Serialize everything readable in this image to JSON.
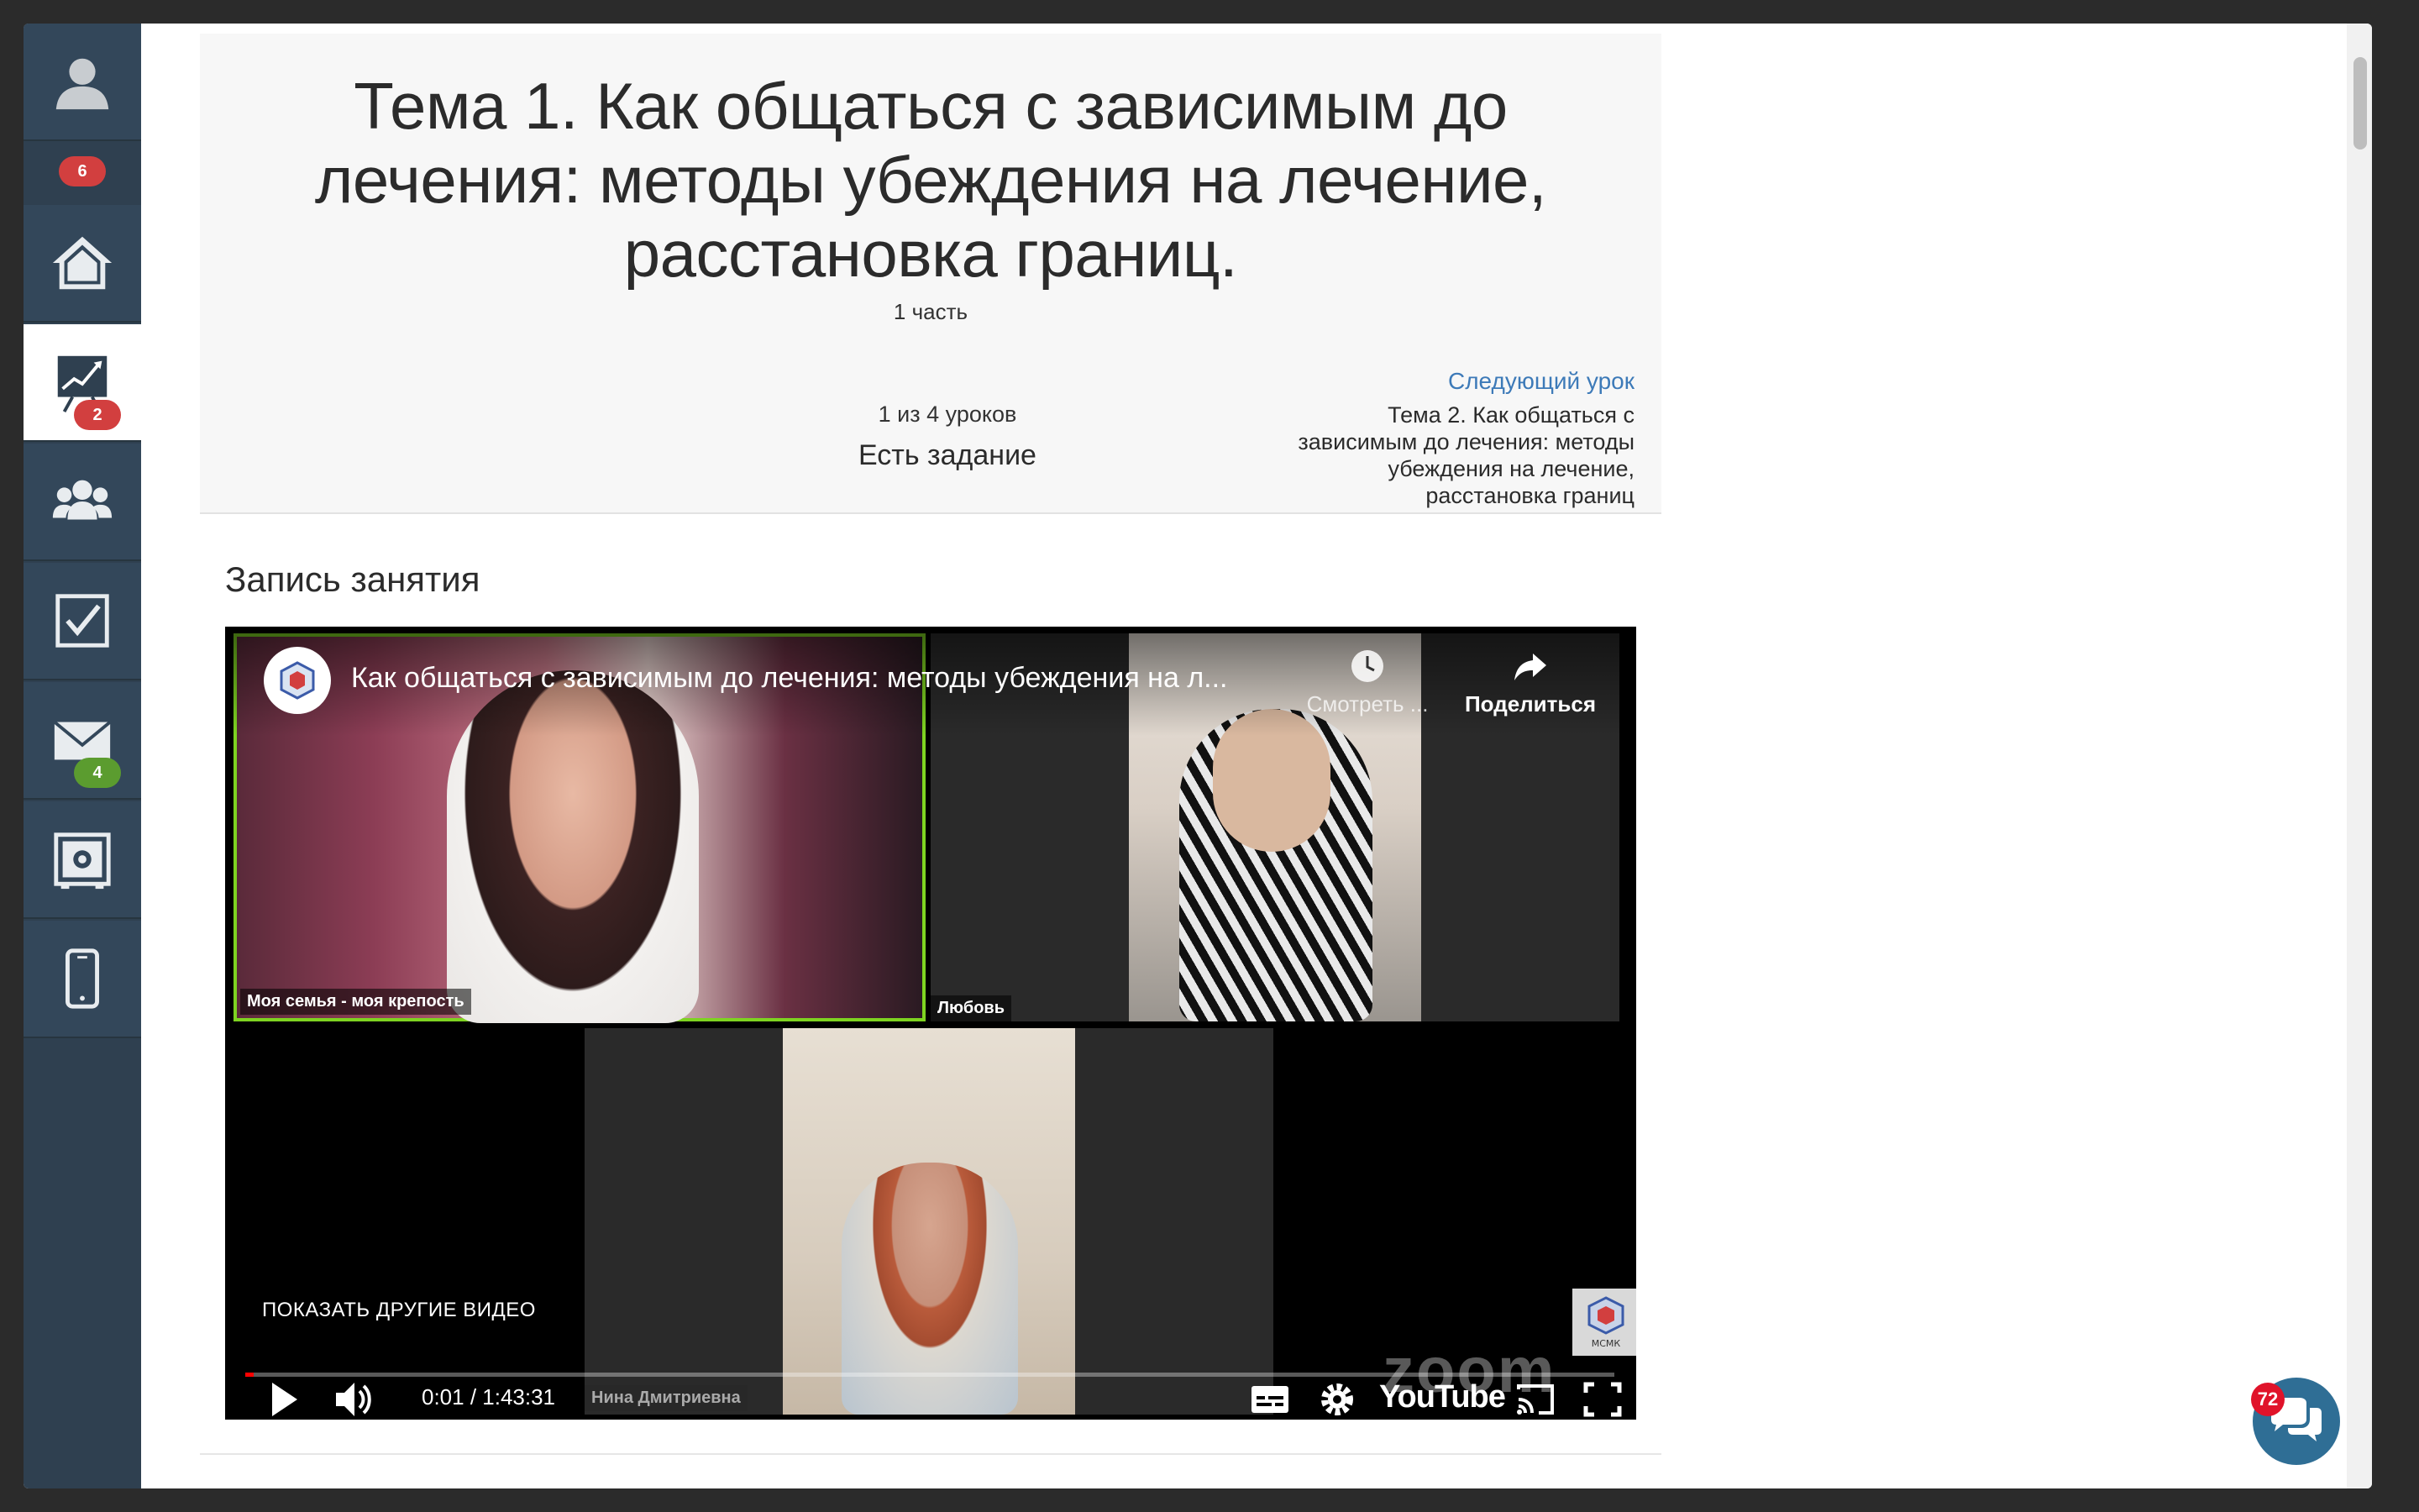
{
  "sidebar": {
    "items": [
      {
        "name": "avatar",
        "icon": "user-avatar-icon",
        "badge": "6",
        "badge_color": "#d23f3f"
      },
      {
        "name": "home",
        "icon": "home-icon"
      },
      {
        "name": "lessons",
        "icon": "chart-board-icon",
        "badge": "2",
        "badge_color": "#d23f3f",
        "active": true
      },
      {
        "name": "groups",
        "icon": "users-icon"
      },
      {
        "name": "tasks",
        "icon": "checkbox-icon"
      },
      {
        "name": "messages",
        "icon": "mail-icon",
        "badge": "4",
        "badge_color": "#5b9c2f"
      },
      {
        "name": "safe",
        "icon": "safe-icon"
      },
      {
        "name": "mobile",
        "icon": "phone-icon"
      }
    ]
  },
  "lesson": {
    "title": "Тема 1. Как общаться с зависимым до лечения: методы убеждения на лечение, расстановка границ.",
    "part": "1 часть",
    "progress": "1 из 4 уроков",
    "task_status": "Есть задание",
    "next_link": "Следующий урок",
    "next_title": "Тема 2. Как общаться с зависимым до лечения: методы убеждения на лечение, расстановка границ"
  },
  "section": {
    "title": "Запись занятия"
  },
  "video": {
    "title": "Как общаться с зависимым до лечения: методы убеждения на л...",
    "watch_later": "Смотреть ...",
    "share": "Поделиться",
    "more_videos": "ПОКАЗАТЬ ДРУГИЕ ВИДЕО",
    "time": "0:01 / 1:43:31",
    "brand": "YouTube",
    "zoom_watermark": "zoom",
    "logo_text": "МСМК",
    "played_fraction": 0.006,
    "participants": [
      "Моя семья - моя крепость",
      "Любовь",
      "Нина Дмитриевна"
    ]
  },
  "chat": {
    "badge": "72"
  },
  "colors": {
    "sidebar_bg": "#2f4050",
    "link": "#3d7ab8",
    "active_speaker": "#7ed321",
    "chat_button": "#2f6e95"
  }
}
